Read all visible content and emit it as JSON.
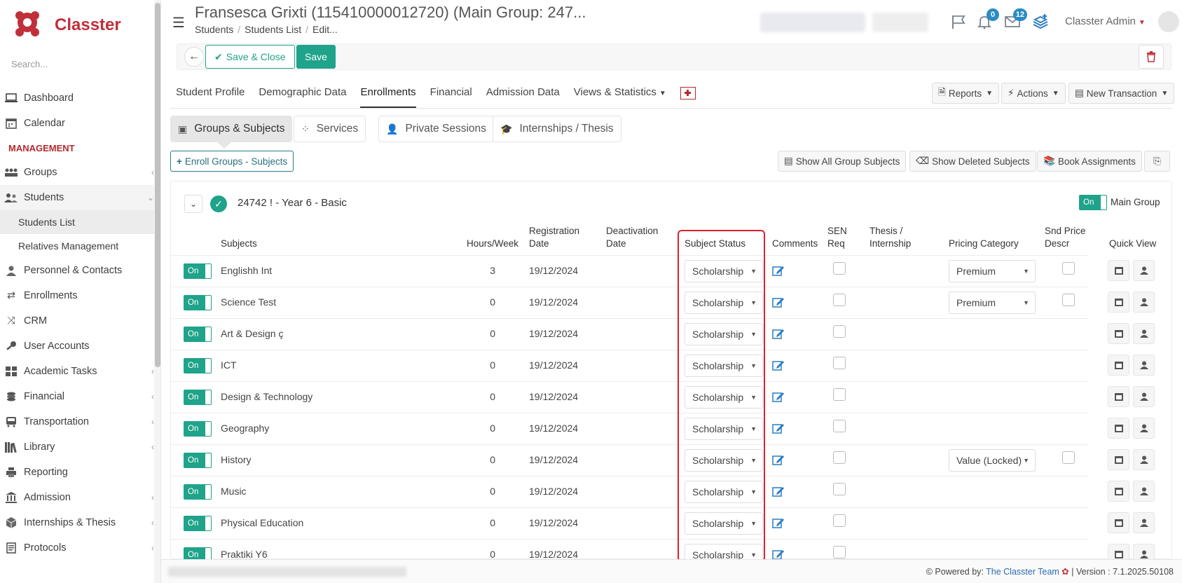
{
  "app": {
    "name": "Classter",
    "search_placeholder": "Search..."
  },
  "sidebar": {
    "items": [
      {
        "label": "Dashboard",
        "icon": "laptop-icon"
      },
      {
        "label": "Calendar",
        "icon": "calendar-icon"
      }
    ],
    "section": "MANAGEMENT",
    "management": [
      {
        "label": "Groups",
        "icon": "groups-icon",
        "chevron": "‹"
      },
      {
        "label": "Students",
        "icon": "students-icon",
        "chevron": "⌄"
      },
      {
        "label": "Students List"
      },
      {
        "label": "Relatives Management"
      },
      {
        "label": "Personnel & Contacts",
        "icon": "person-icon"
      },
      {
        "label": "Enrollments",
        "icon": "swap-icon"
      },
      {
        "label": "CRM",
        "icon": "crm-icon"
      },
      {
        "label": "User Accounts",
        "icon": "key-icon"
      },
      {
        "label": "Academic Tasks",
        "icon": "tasks-icon",
        "chevron": "‹"
      },
      {
        "label": "Financial",
        "icon": "coins-icon",
        "chevron": "‹"
      },
      {
        "label": "Transportation",
        "icon": "bus-icon",
        "chevron": "‹"
      },
      {
        "label": "Library",
        "icon": "library-icon",
        "chevron": "‹"
      },
      {
        "label": "Reporting",
        "icon": "printer-icon"
      },
      {
        "label": "Admission",
        "icon": "institution-icon",
        "chevron": "‹"
      },
      {
        "label": "Internships & Thesis",
        "icon": "cube-icon",
        "chevron": "‹"
      },
      {
        "label": "Protocols",
        "icon": "protocol-icon",
        "chevron": "‹"
      }
    ]
  },
  "header": {
    "title": "Fransesca Grixti (115410000012720) (Main Group: 247...",
    "breadcrumb": [
      "Students",
      "Students List",
      "Edit..."
    ],
    "notifications_count": "0",
    "messages_count": "12",
    "user": "Classter Admin"
  },
  "toolbar": {
    "save_close": "Save & Close",
    "save": "Save"
  },
  "tabs": [
    "Student Profile",
    "Demographic Data",
    "Enrollments",
    "Financial",
    "Admission Data",
    "Views & Statistics"
  ],
  "right_buttons": {
    "reports": "Reports",
    "actions": "Actions",
    "new_transaction": "New Transaction"
  },
  "subtabs": [
    "Groups & Subjects",
    "Services",
    "Private Sessions",
    "Internships / Thesis"
  ],
  "actions": {
    "enroll": "Enroll Groups - Subjects",
    "show_all": "Show All Group Subjects",
    "show_deleted": "Show Deleted Subjects",
    "book_assignments": "Book Assignments"
  },
  "group": {
    "name": "24742 ! - Year 6 - Basic",
    "main_toggle": "On",
    "main_label": "Main Group"
  },
  "columns": {
    "subjects": "Subjects",
    "hours": "Hours/Week",
    "registration": "Registration Date",
    "deactivation": "Deactivation Date",
    "status": "Subject Status",
    "comments": "Comments",
    "sen": "SEN Req",
    "thesis": "Thesis / Internship",
    "pricing": "Pricing Category",
    "snd_price": "Snd Price Descr",
    "quick_view": "Quick View"
  },
  "rows": [
    {
      "toggle": "On",
      "subject": "Englishh Int",
      "hours": "3",
      "date": "19/12/2024",
      "status": "Scholarship",
      "pricing": "Premium"
    },
    {
      "toggle": "On",
      "subject": "Science Test",
      "hours": "0",
      "date": "19/12/2024",
      "status": "Scholarship",
      "pricing": "Premium"
    },
    {
      "toggle": "On",
      "subject": "Art & Design ç",
      "hours": "0",
      "date": "19/12/2024",
      "status": "Scholarship",
      "pricing": ""
    },
    {
      "toggle": "On",
      "subject": "ICT",
      "hours": "0",
      "date": "19/12/2024",
      "status": "Scholarship",
      "pricing": ""
    },
    {
      "toggle": "On",
      "subject": "Design & Technology",
      "hours": "0",
      "date": "19/12/2024",
      "status": "Scholarship",
      "pricing": ""
    },
    {
      "toggle": "On",
      "subject": "Geography",
      "hours": "0",
      "date": "19/12/2024",
      "status": "Scholarship",
      "pricing": ""
    },
    {
      "toggle": "On",
      "subject": "History",
      "hours": "0",
      "date": "19/12/2024",
      "status": "Scholarship",
      "pricing": "Value (Locked)"
    },
    {
      "toggle": "On",
      "subject": "Music",
      "hours": "0",
      "date": "19/12/2024",
      "status": "Scholarship",
      "pricing": ""
    },
    {
      "toggle": "On",
      "subject": "Physical Education",
      "hours": "0",
      "date": "19/12/2024",
      "status": "Scholarship",
      "pricing": ""
    },
    {
      "toggle": "On",
      "subject": "Praktiki Y6",
      "hours": "0",
      "date": "19/12/2024",
      "status": "Scholarship",
      "pricing": ""
    }
  ],
  "footer": {
    "powered": "Powered by:",
    "team": "The Classter Team",
    "version": "| Version : 7.1.2025.50108"
  },
  "colors": {
    "accent": "#1fa38a",
    "brand": "#c0303a",
    "highlight": "#e0202a",
    "link": "#2b7cc4"
  }
}
